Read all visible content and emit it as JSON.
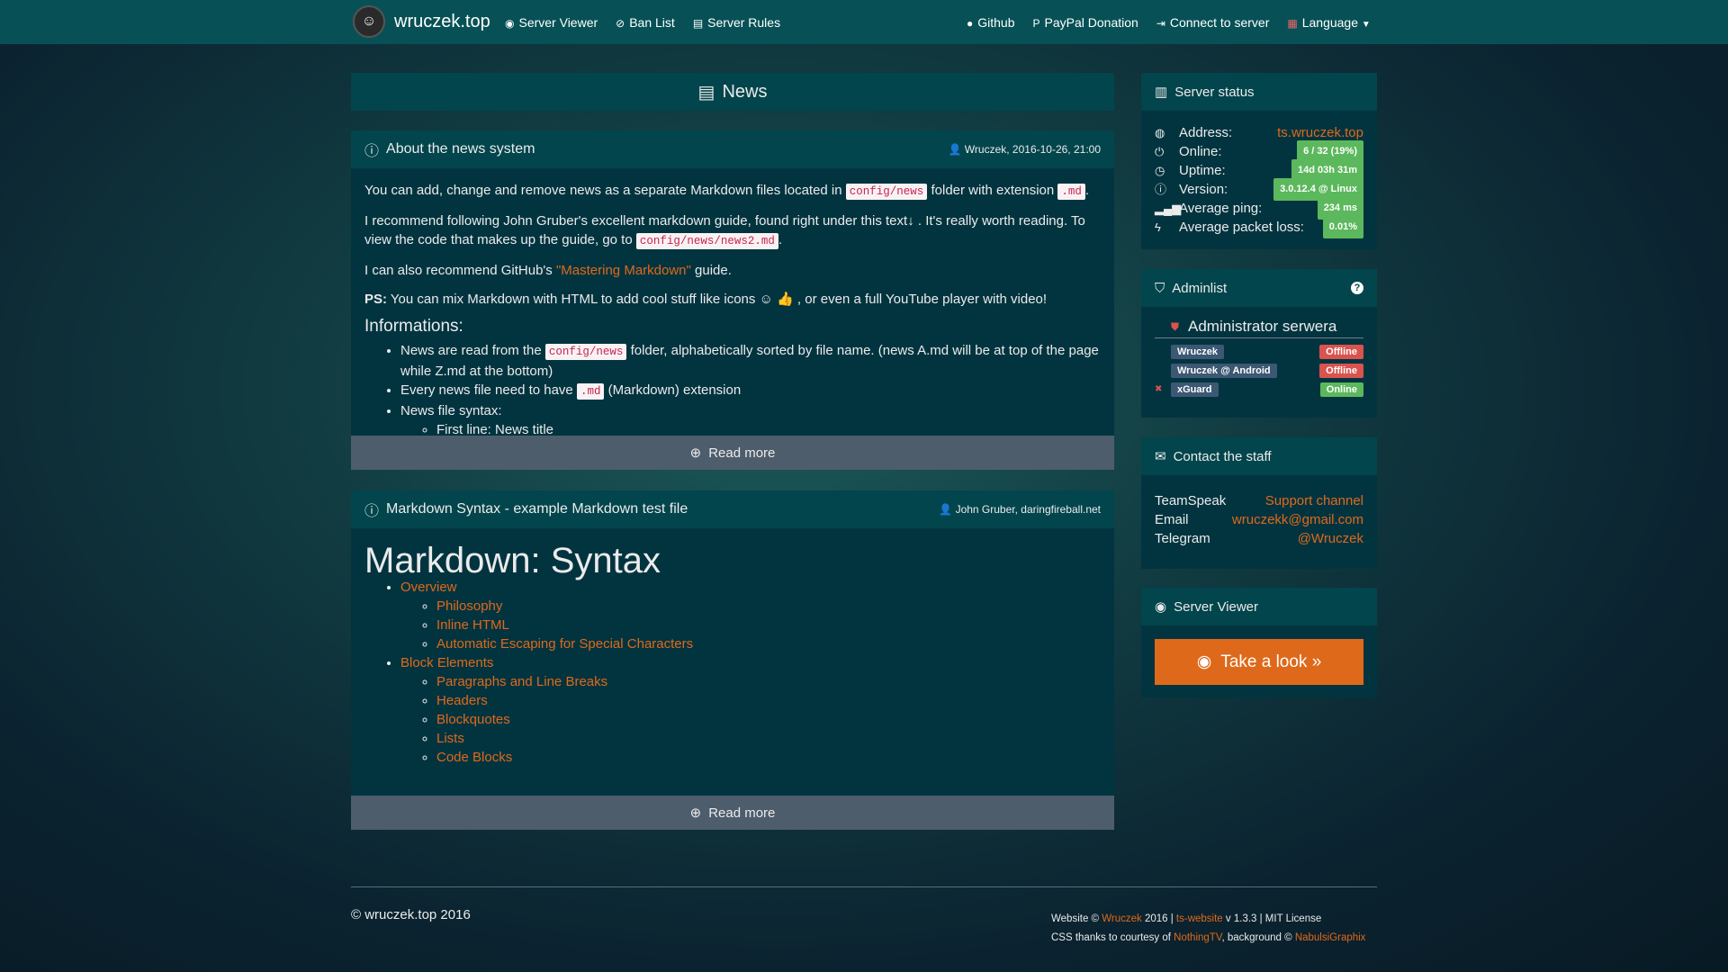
{
  "nav": {
    "brand": "wruczek.top",
    "left": [
      "Server Viewer",
      "Ban List",
      "Server Rules"
    ],
    "right": [
      "Github",
      "PayPal Donation",
      "Connect to server",
      "Language"
    ]
  },
  "news_title": "News",
  "news": [
    {
      "title": "About the news system",
      "meta": "Wruczek, 2016-10-26, 21:00",
      "p1a": "You can add, change and remove news as a separate Markdown files located in",
      "p1code": "config/news",
      "p1b": "folder with extension",
      "p1code2": ".md",
      "p1c": ".",
      "p2a": "I recommend following John Gruber's excellent markdown guide, found right under this text",
      "p2arrow": "↓",
      "p2b": ". It's really worth reading. To view the code that makes up the guide, go to",
      "p2code": "config/news/news2.md",
      "p2c": ".",
      "p3a": "I can also recommend GitHub's",
      "p3link": "\"Mastering Markdown\"",
      "p3b": "guide.",
      "p4bold": "PS:",
      "p4a": "You can mix Markdown with HTML to add cool stuff like icons",
      "p4b": ", or even a full YouTube player with video!",
      "h": "Informations:",
      "li1a": "News are read from the",
      "li1code": "config/news",
      "li1b": "folder, alphabetically sorted by file name. (news A.md will be at top of the page while Z.md at the bottom)",
      "li2a": "Every news file need to have",
      "li2code": ".md",
      "li2b": "(Markdown) extension",
      "li3": "News file syntax:",
      "li3sub": "First line: News title"
    },
    {
      "title": "Markdown Syntax - example Markdown test file",
      "meta": "John Gruber, daringfireball.net",
      "h1": "Markdown: Syntax",
      "toc": [
        {
          "label": "Overview",
          "sub": [
            "Philosophy",
            "Inline HTML",
            "Automatic Escaping for Special Characters"
          ]
        },
        {
          "label": "Block Elements",
          "sub": [
            "Paragraphs and Line Breaks",
            "Headers",
            "Blockquotes",
            "Lists",
            "Code Blocks"
          ]
        }
      ]
    }
  ],
  "read_more": "Read more",
  "status": {
    "title": "Server status",
    "rows": [
      {
        "label": "Address:",
        "value": "ts.wruczek.top"
      },
      {
        "label": "Online:",
        "value": "6 / 32 (19%)"
      },
      {
        "label": "Uptime:",
        "value": "14d 03h 31m"
      },
      {
        "label": "Version:",
        "value": "3.0.12.4 @ Linux"
      },
      {
        "label": "Average ping:",
        "value": "234 ms"
      },
      {
        "label": "Average packet loss:",
        "value": "0.01%"
      }
    ]
  },
  "adminlist": {
    "title": "Adminlist",
    "group": "Administrator serwera",
    "admins": [
      {
        "name": "Wruczek",
        "status": "Offline"
      },
      {
        "name": "Wruczek @ Android",
        "status": "Offline"
      },
      {
        "name": "xGuard",
        "status": "Online"
      }
    ]
  },
  "contact": {
    "title": "Contact the staff",
    "rows": [
      {
        "label": "TeamSpeak",
        "value": "Support channel"
      },
      {
        "label": "Email",
        "value": "wruczekk@gmail.com"
      },
      {
        "label": "Telegram",
        "value": "@Wruczek"
      }
    ]
  },
  "viewer": {
    "title": "Server Viewer",
    "button": "Take a look »"
  },
  "footer": {
    "copy": "© wruczek.top 2016",
    "l1a": "Website ©",
    "l1link": "Wruczek",
    "l1b": "2016 |",
    "l1link2": "ts-website",
    "l1c": "v 1.3.3 | MIT License",
    "l2a": "CSS thanks to courtesy of",
    "l2link": "NothingTV",
    "l2b": ", background ©",
    "l2link2": "NabulsiGraphix"
  },
  "colors": {
    "accent": "#df691a",
    "success": "#5cb85c",
    "danger": "#d9534f",
    "navbar": "#075156"
  }
}
